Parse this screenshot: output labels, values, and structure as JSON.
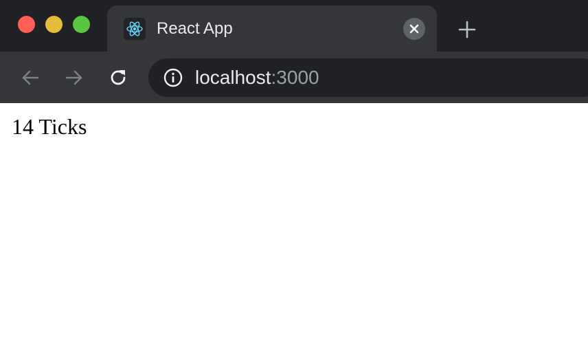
{
  "window": {
    "controls": [
      "close",
      "minimize",
      "maximize"
    ]
  },
  "tab": {
    "title": "React App",
    "favicon": "react-logo-icon",
    "close_icon": "close-icon"
  },
  "new_tab_icon": "plus-icon",
  "toolbar": {
    "back_icon": "arrow-left-icon",
    "forward_icon": "arrow-right-icon",
    "reload_icon": "reload-icon",
    "security_icon": "info-icon",
    "url_host": "localhost",
    "url_port": ":3000"
  },
  "page": {
    "text": "14 Ticks"
  },
  "colors": {
    "tabstrip": "#202124",
    "toolbar": "#35363a",
    "react": "#61dafb"
  }
}
